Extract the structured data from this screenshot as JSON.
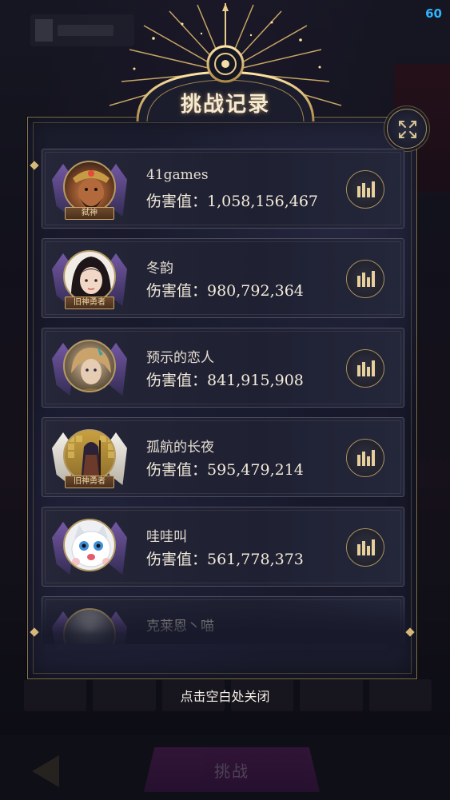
{
  "fps": "60",
  "title": "挑战记录",
  "close_hint": "点击空白处关闭",
  "background": {
    "challenge_button": "挑战"
  },
  "records": [
    {
      "name": "41games",
      "damage": "伤害值：1,058,156,467",
      "avatar_tag": "弑神",
      "avatar": "bearded-warrior"
    },
    {
      "name": "冬韵",
      "damage": "伤害值：980,792,364",
      "avatar_tag": "旧神勇者",
      "avatar": "dark-haired-lady"
    },
    {
      "name": "预示的恋人",
      "damage": "伤害值：841,915,908",
      "avatar_tag": "",
      "avatar": "golden-haired-man"
    },
    {
      "name": "孤航的长夜",
      "damage": "伤害值：595,479,214",
      "avatar_tag": "旧神勇者",
      "avatar": "hooded-mage"
    },
    {
      "name": "哇哇叫",
      "damage": "伤害值：561,778,373",
      "avatar_tag": "",
      "avatar": "white-kitten"
    },
    {
      "name": "克莱恩丶喵",
      "damage": "",
      "avatar_tag": "",
      "avatar": "partial"
    }
  ],
  "colors": {
    "gold": "#c9ab6e",
    "panel_bg": "#161829",
    "row_border": "#4f4d5c",
    "fps": "#2fb4ff"
  }
}
